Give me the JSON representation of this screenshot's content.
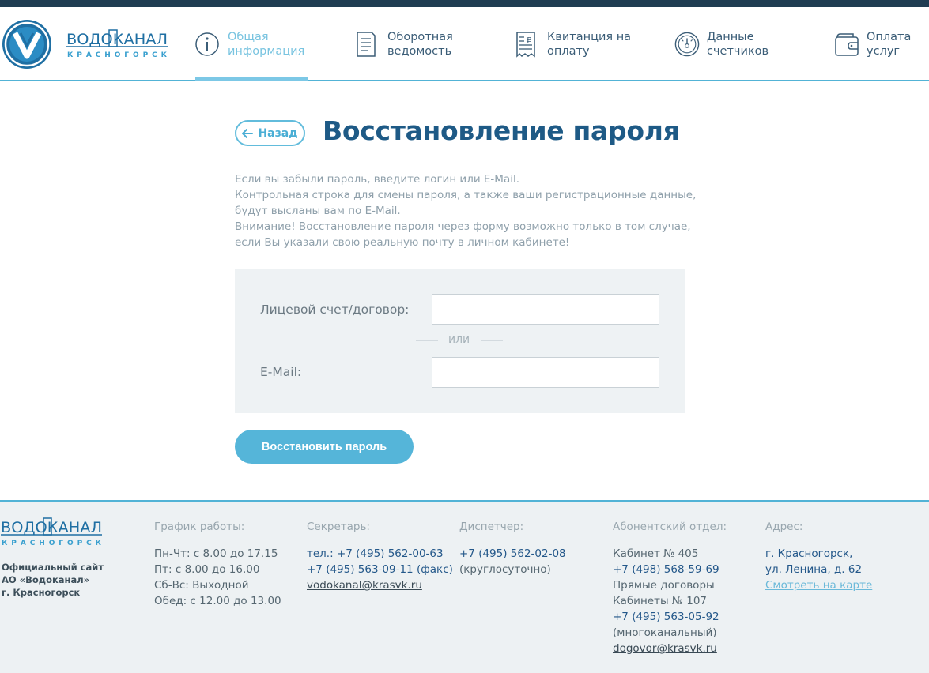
{
  "header": {
    "logo": {
      "word": "ВОДОКАНАЛ",
      "city": "КРАСНОГОРСК"
    },
    "nav": [
      {
        "label": "Общая\nинформация",
        "icon": "info-icon",
        "active": true
      },
      {
        "label": "Оборотная\nведомость",
        "icon": "document-icon",
        "active": false
      },
      {
        "label": "Квитанция на\nоплату",
        "icon": "receipt-icon",
        "active": false
      },
      {
        "label": "Данные\nсчетчиков",
        "icon": "meter-icon",
        "active": false
      },
      {
        "label": "Оплата\nуслуг",
        "icon": "wallet-icon",
        "active": false
      }
    ]
  },
  "main": {
    "back_label": "Назад",
    "title": "Восстановление пароля",
    "info_lines": [
      "Если вы забыли пароль, введите логин или E-Mail.",
      "Контрольная строка для смены пароля, а также ваши регистрационные данные,",
      "будут высланы вам по E-Mail.",
      "Внимание! Восстановление пароля через форму возможно только в том случае,",
      "если Вы указали свою реальную почту в личном кабинете!"
    ],
    "form": {
      "account_label": "Лицевой счет/договор:",
      "account_value": "",
      "or_text": "или",
      "email_label": "E-Mail:",
      "email_value": ""
    },
    "submit_label": "Восстановить пароль"
  },
  "footer": {
    "logo": {
      "word": "ВОДОКАНАЛ",
      "city": "КРАСНОГОРСК"
    },
    "site_lines": [
      "Официальный сайт",
      "АО «Водоканал»",
      "г. Красногорск"
    ],
    "schedule": {
      "heading": "График работы:",
      "lines": [
        "Пн-Чт: с 8.00 до 17.15",
        "Пт: с 8.00 до 16.00",
        "Сб-Вс: Выходной",
        "Обед: с 12.00 до 13.00"
      ]
    },
    "secretary": {
      "heading": "Секретарь:",
      "tel_prefix": "тел.:",
      "tel1": "+7 (495) 562-00-63",
      "tel2": "+7 (495) 563-09-11",
      "fax_suffix": "(факс)",
      "email": "vodokanal@krasvk.ru"
    },
    "dispatcher": {
      "heading": "Диспетчер:",
      "phone": "+7 (495) 562-02-08",
      "note": "(круглосуточно)"
    },
    "subscriber": {
      "heading": "Абонентский отдел:",
      "office1": "Кабинет № 405",
      "phone1": "+7 (498) 568-59-69",
      "direct": "Прямые договоры",
      "office2": "Кабинеты № 107",
      "phone2": "+7 (495) 563-05-92",
      "note": "(многоканальный)",
      "email": "dogovor@krasvk.ru"
    },
    "address": {
      "heading": "Адрес:",
      "line1": "г. Красногорск,",
      "line2": "ул. Ленина, д. 62",
      "map_link": "Смотреть на карте"
    }
  },
  "colors": {
    "brand_dark": "#1e5a86",
    "accent": "#55b5d9",
    "topbar": "#1f3d52"
  }
}
